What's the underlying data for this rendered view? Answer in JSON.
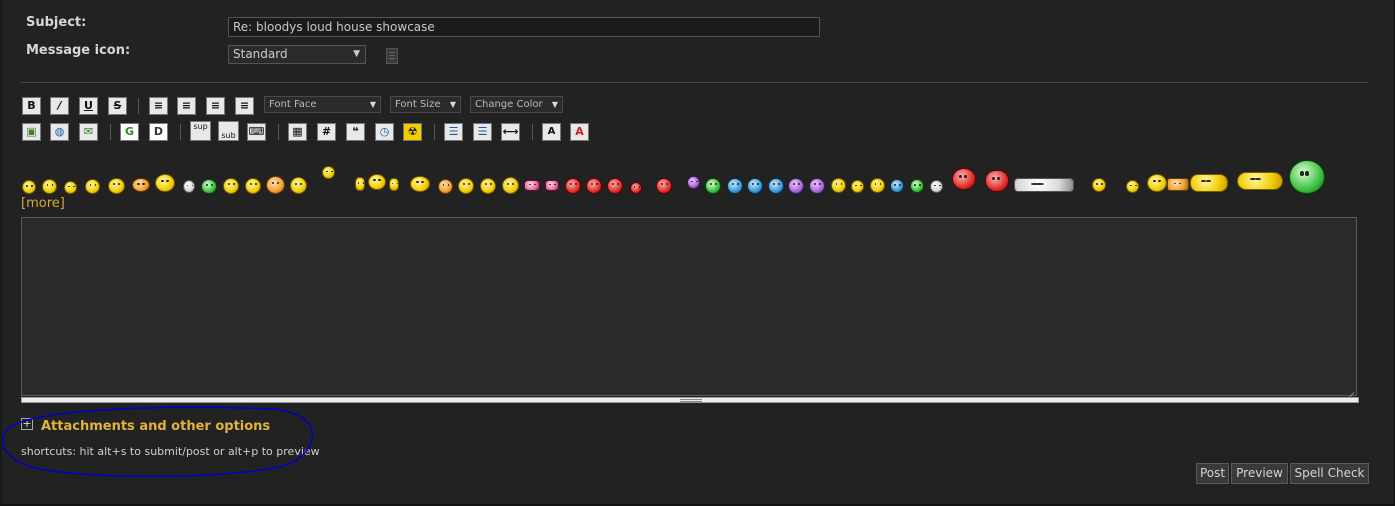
{
  "form": {
    "subject_label": "Subject:",
    "subject_value": "Re: bloodys loud house showcase",
    "message_icon_label": "Message icon:",
    "message_icon_value": "Standard"
  },
  "toolbar": {
    "row1": [
      {
        "name": "bold-button",
        "label": "B"
      },
      {
        "name": "italic-button",
        "label": "/"
      },
      {
        "name": "underline-button",
        "label": "U"
      },
      {
        "name": "strikethrough-button",
        "label": "S"
      },
      {
        "name": "align-left-button",
        "label": "≡"
      },
      {
        "name": "align-justify-button",
        "label": "≡"
      },
      {
        "name": "align-center-button",
        "label": "≡"
      },
      {
        "name": "align-right-button",
        "label": "≡"
      }
    ],
    "font_face": "Font Face",
    "font_size": "Font Size",
    "change_color": "Change Color",
    "row2": [
      {
        "name": "insert-image-button",
        "label": "▣"
      },
      {
        "name": "insert-link-button",
        "label": "◍"
      },
      {
        "name": "insert-email-button",
        "label": "✉"
      },
      {
        "name": "google-search-button",
        "label": "G"
      },
      {
        "name": "wiki-button",
        "label": "D"
      },
      {
        "name": "superscript-button",
        "label": "sup"
      },
      {
        "name": "subscript-button",
        "label": "sub"
      },
      {
        "name": "teletype-button",
        "label": "⌨"
      },
      {
        "name": "insert-table-button",
        "label": "▦"
      },
      {
        "name": "insert-code-button",
        "label": "#"
      },
      {
        "name": "insert-quote-button",
        "label": "❝"
      },
      {
        "name": "insert-time-button",
        "label": "◷"
      },
      {
        "name": "spoiler-button",
        "label": "☢"
      },
      {
        "name": "bullet-list-button",
        "label": "☰"
      },
      {
        "name": "numbered-list-button",
        "label": "☰"
      },
      {
        "name": "horizontal-rule-button",
        "label": "⟷"
      },
      {
        "name": "font-size-button",
        "label": "A"
      },
      {
        "name": "font-color-button",
        "label": "A"
      }
    ]
  },
  "smileys": {
    "count": 52,
    "more_label": "[more]"
  },
  "attachments": {
    "toggle_symbol": "+",
    "title": "Attachments and other options"
  },
  "shortcuts_text": "shortcuts: hit alt+s to submit/post or alt+p to preview",
  "buttons": {
    "post": "Post",
    "preview": "Preview",
    "spell_check": "Spell Check"
  },
  "colors": {
    "background": "#222222",
    "accent_gold": "#e0b33d",
    "annotation_circle": "#0000cc"
  }
}
